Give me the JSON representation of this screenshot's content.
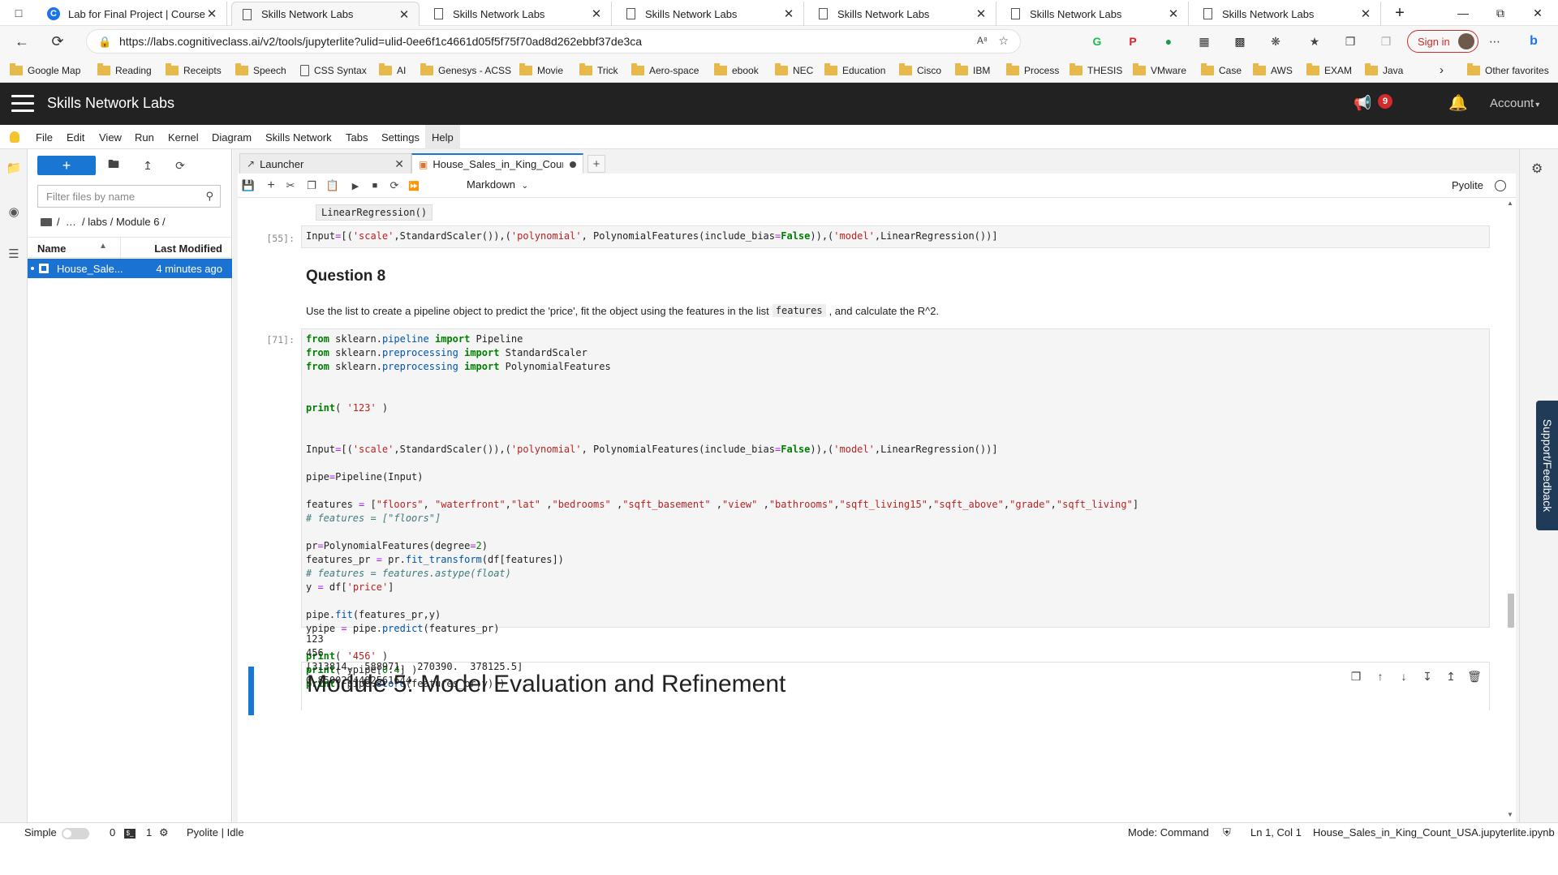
{
  "browser": {
    "tabs": [
      {
        "title": "Lab for Final Project | Coursera",
        "icon": "coursera-icon",
        "active": false
      },
      {
        "title": "Skills Network Labs",
        "icon": "page-icon",
        "active": true
      },
      {
        "title": "Skills Network Labs",
        "icon": "page-icon",
        "active": false
      },
      {
        "title": "Skills Network Labs",
        "icon": "page-icon",
        "active": false
      },
      {
        "title": "Skills Network Labs",
        "icon": "page-icon",
        "active": false
      },
      {
        "title": "Skills Network Labs",
        "icon": "page-icon",
        "active": false
      },
      {
        "title": "Skills Network Labs",
        "icon": "page-icon",
        "active": false
      }
    ],
    "url": "https://labs.cognitiveclass.ai/v2/tools/jupyterlite?ulid=ulid-0ee6f1c4661d05f5f75f70ad8d262ebbf37de3ca",
    "signin_label": "Sign in",
    "bookmarks": [
      "Google Map",
      "Reading",
      "Receipts",
      "Speech",
      "CSS Syntax",
      "AI",
      "Genesys - ACSS",
      "Movie",
      "Trick",
      "Aero-space",
      "ebook",
      "NEC",
      "Education",
      "Cisco",
      "IBM",
      "Process",
      "THESIS",
      "VMware",
      "Case",
      "AWS",
      "EXAM",
      "Java"
    ],
    "other_favorites": "Other favorites"
  },
  "header": {
    "brand": "Skills Network Labs",
    "notification_count": "9",
    "account_label": "Account"
  },
  "menu": [
    "File",
    "Edit",
    "View",
    "Run",
    "Kernel",
    "Diagram",
    "Skills Network",
    "Tabs",
    "Settings",
    "Help"
  ],
  "filebrowser": {
    "filter_placeholder": "Filter files by name",
    "breadcrumb": "/  …  / labs / Module 6 /",
    "col_name": "Name",
    "col_modified": "Last Modified",
    "file": {
      "name": "House_Sale...",
      "modified": "4 minutes ago"
    }
  },
  "doctabs": {
    "launcher": "Launcher",
    "notebook": "House_Sales_in_King_Count_"
  },
  "toolbar": {
    "cell_type": "Markdown",
    "kernel": "Pyolite"
  },
  "notebook": {
    "prev_output": "LinearRegression()",
    "cell55_prompt": "[55]:",
    "q8_title": "Question 8",
    "q8_desc_before": "Use the list to create a pipeline object to predict the 'price', fit the object using the features in the list",
    "q8_desc_code": "features",
    "q8_desc_after": ", and calculate the R^2.",
    "cell71_prompt": "[71]:",
    "outputs": [
      "123",
      "456",
      "[313814.  588971.  270390.  378125.5]",
      "0.8500294482561644"
    ],
    "module_title": "Module 5: Model Evaluation and Refinement"
  },
  "side": {
    "support_label": "Support/Feedback"
  },
  "status": {
    "mode_simple": "Simple",
    "count_a": "0",
    "count_b": "1",
    "kernel_state": "Pyolite | Idle",
    "mode": "Mode: Command",
    "position": "Ln 1, Col 1",
    "filename": "House_Sales_in_King_Count_USA.jupyterlite.ipynb"
  },
  "colors": {
    "accent": "#1976d2",
    "header_bg": "#222222",
    "badge": "#d22b2b",
    "support_bg": "#1f3b57"
  }
}
